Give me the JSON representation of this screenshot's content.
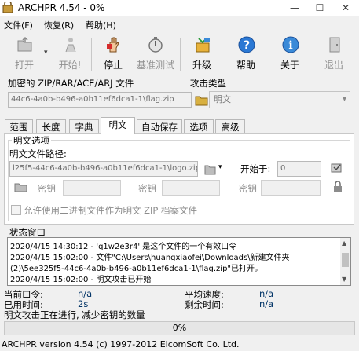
{
  "window": {
    "title": "ARCHPR 4.54 - 0%",
    "minimize": "—",
    "maximize": "☐",
    "close": "✕"
  },
  "menu": [
    "文件(F)",
    "恢复(R)",
    "帮助(H)"
  ],
  "toolbar": {
    "open": "打开",
    "start": "开始!",
    "stop": "停止",
    "benchmark": "基准测试",
    "upgrade": "升级",
    "help": "帮助",
    "about": "关于",
    "exit": "退出"
  },
  "encrypted_file": {
    "label": "加密的 ZIP/RAR/ACE/ARJ 文件",
    "value": "44c6-4a0b-b496-a0b11ef6dca1-1\\flag.zip"
  },
  "attack_type": {
    "label": "攻击类型",
    "value": "明文"
  },
  "tabs": [
    "范围",
    "长度",
    "字典",
    "明文",
    "自动保存",
    "选项",
    "高级"
  ],
  "plaintext": {
    "group_label": "明文选项",
    "path_label": "明文文件路径:",
    "path_value": "l25f5-44c6-4a0b-b496-a0b11ef6dca1-1\\logo.zip",
    "start_at_label": "开始于:",
    "start_at_value": "0",
    "key_label": "密钥",
    "checkbox_label": "允许使用二进制文件作为明文 ZIP 档案文件"
  },
  "status": {
    "label": "状态窗口",
    "lines": [
      "2020/4/15 14:30:12 - 'q1w2e3r4' 是这个文件的一个有效口令",
      "2020/4/15 15:02:00 - 文件\"C:\\Users\\huangxiaofei\\Downloads\\新建文件夹",
      "(2)\\5ee325f5-44c6-4a0b-b496-a0b11ef6dca1-1\\flag.zip\"已打开。",
      "2020/4/15 15:02:00 - 明文攻击已开始"
    ]
  },
  "stats": {
    "current_password_label": "当前口令:",
    "current_password_value": "n/a",
    "average_speed_label": "平均速度:",
    "average_speed_value": "n/a",
    "elapsed_label": "已用时间:",
    "elapsed_value": "2s",
    "remaining_label": "剩余时间:",
    "remaining_value": "n/a",
    "message": "明文攻击正在进行, 减少密钥的数量"
  },
  "progress": {
    "percent": 0,
    "text": "0%"
  },
  "statusbar": "ARCHPR version 4.54 (c) 1997-2012 ElcomSoft Co. Ltd.",
  "colors": {
    "value_text": "#003366",
    "help_blue": "#2a78d4",
    "stop_red": "#d62b2b"
  }
}
